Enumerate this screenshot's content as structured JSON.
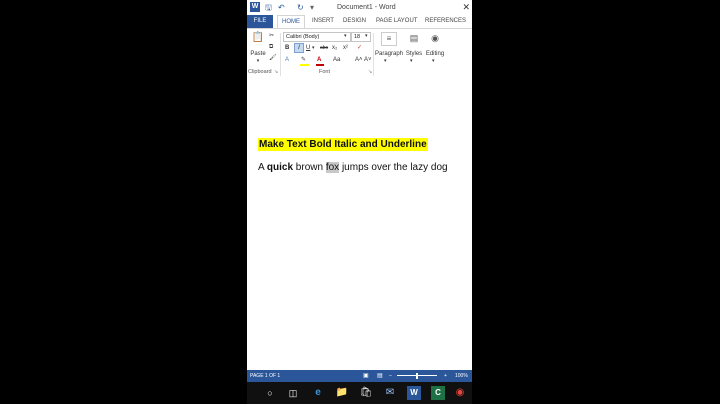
{
  "window": {
    "title": "Document1 - Word",
    "app_logo": "W"
  },
  "quick_access": {
    "save_icon": "save-icon",
    "undo_icon": "undo-icon",
    "redo_icon": "redo-icon"
  },
  "tabs": [
    "FILE",
    "HOME",
    "INSERT",
    "DESIGN",
    "PAGE LAYOUT",
    "REFERENCES"
  ],
  "ribbon": {
    "clipboard": {
      "paste_label": "Paste",
      "group_label": "Clipboard"
    },
    "font": {
      "font_name": "Calibri (Body)",
      "font_size": "18",
      "bold": "B",
      "italic": "I",
      "underline": "U",
      "strike": "abc",
      "subscript": "x₂",
      "superscript": "x²",
      "font_color": "A",
      "change_case": "Aa",
      "grow": "A˄",
      "shrink": "A˅",
      "group_label": "Font"
    },
    "paragraph_label": "Paragraph",
    "styles_label": "Styles",
    "editing_label": "Editing"
  },
  "document": {
    "heading": "Make Text Bold Italic and Underline",
    "sentence_prefix": "A ",
    "sentence_bold": "quick",
    "sentence_middle": " brown ",
    "sentence_selected": "fox",
    "sentence_suffix": " jumps over the lazy dog"
  },
  "status": {
    "page": "PAGE 1 OF 1",
    "zoom": "100%"
  },
  "colors": {
    "brand": "#2b579a",
    "highlight": "#ffff00",
    "selection": "#c8c8c8"
  }
}
